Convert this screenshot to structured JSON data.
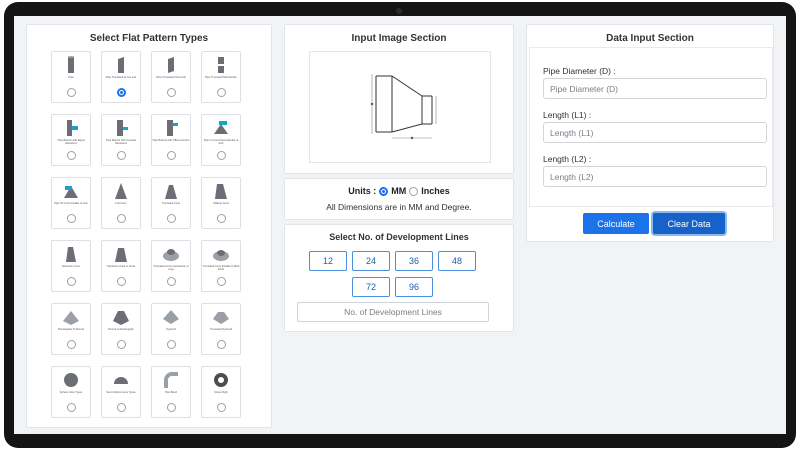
{
  "left_panel": {
    "title": "Select Flat Pattern Types",
    "items": [
      {
        "label": "Pipe",
        "icon": "pipe-icon",
        "checked": false
      },
      {
        "label": "Pipe Truncated at one end",
        "icon": "truncated-pipe-icon",
        "checked": true
      },
      {
        "label": "Pipe Truncated both ends",
        "icon": "truncated-both-pipe-icon",
        "checked": false
      },
      {
        "label": "Pipe Truncated Mid-Section",
        "icon": "truncated-mid-pipe-icon",
        "checked": false
      },
      {
        "label": "Pipe Branch with Equal Diameters",
        "icon": "branch-equal-icon",
        "checked": false
      },
      {
        "label": "Pipe Branch with Unequal Diameters",
        "icon": "branch-unequal-icon",
        "checked": false
      },
      {
        "label": "Pipe Branch with Offset Centers",
        "icon": "branch-offset-icon",
        "checked": false
      },
      {
        "label": "Pipe to Cone Perpendicular to Axis",
        "icon": "pipe-to-cone-icon",
        "checked": false
      },
      {
        "label": "Pipe To Cone Parallel to Axis",
        "icon": "pipe-cone-parallel-icon",
        "checked": false
      },
      {
        "label": "Full Cone",
        "icon": "full-cone-icon",
        "checked": false
      },
      {
        "label": "Truncated Cone",
        "icon": "truncated-cone-icon",
        "checked": false
      },
      {
        "label": "Oblique Cone",
        "icon": "oblique-cone-icon",
        "checked": false
      },
      {
        "label": "Eccentric Cone",
        "icon": "eccentric-cone-icon",
        "checked": false
      },
      {
        "label": "Transition Circle to Circle",
        "icon": "transition-circle-icon",
        "checked": false
      },
      {
        "label": "Truncated Cone Intersection of Legs",
        "icon": "cone-intersection-icon",
        "checked": false
      },
      {
        "label": "Truncated Cone Parallel to Both Ends",
        "icon": "cone-parallel-ends-icon",
        "checked": false
      },
      {
        "label": "Rectangular To Round",
        "icon": "rect-to-round-icon",
        "checked": false
      },
      {
        "label": "Round to Rectangular",
        "icon": "round-to-rect-icon",
        "checked": false
      },
      {
        "label": "Pyramid",
        "icon": "pyramid-icon",
        "checked": false
      },
      {
        "label": "Truncated Pyramid",
        "icon": "truncated-pyramid-icon",
        "checked": false
      },
      {
        "label": "Sphere Gore Types",
        "icon": "sphere-icon",
        "checked": false
      },
      {
        "label": "Semi-Sphere Gore Types",
        "icon": "semi-sphere-icon",
        "checked": false
      },
      {
        "label": "Pipe Bend",
        "icon": "pipe-bend-icon",
        "checked": false
      },
      {
        "label": "Screw Fight",
        "icon": "screw-flight-icon",
        "checked": false
      }
    ]
  },
  "image_section": {
    "title": "Input Image Section",
    "diagram_icon": "reducer-diagram-icon"
  },
  "units": {
    "label": "Units :",
    "options": [
      {
        "label": "MM",
        "checked": true
      },
      {
        "label": "Inches",
        "checked": false
      }
    ],
    "note": "All Dimensions are in MM and Degree."
  },
  "dev_lines": {
    "title": "Select No. of Development Lines",
    "options": [
      "12",
      "24",
      "36",
      "48",
      "72",
      "96"
    ],
    "placeholder": "No. of Development Lines"
  },
  "data_input": {
    "title": "Data Input Section",
    "fields": [
      {
        "label": "Pipe Diameter (D) :",
        "placeholder": "Pipe Diameter (D)"
      },
      {
        "label": "Length (L1) :",
        "placeholder": "Length (L1)"
      },
      {
        "label": "Length (L2) :",
        "placeholder": "Length (L2)"
      }
    ],
    "calculate_label": "Calculate",
    "clear_label": "Clear Data"
  },
  "colors": {
    "accent": "#1a73e8",
    "accent_dark": "#1761c9"
  }
}
